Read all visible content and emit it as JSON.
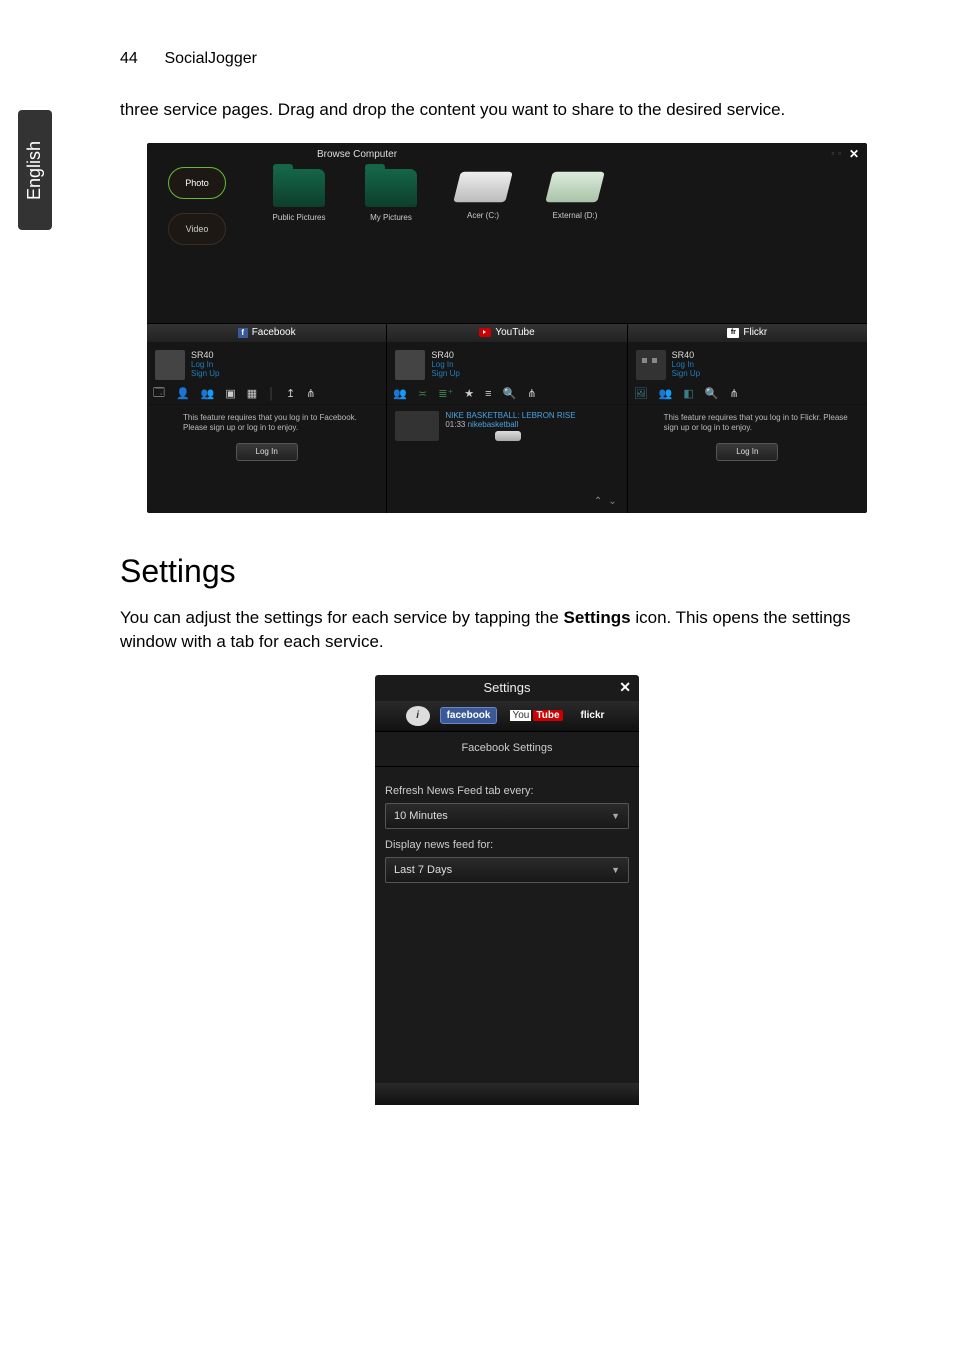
{
  "page": {
    "number": "44",
    "section": "SocialJogger",
    "language_tab": "English"
  },
  "text": {
    "intro_continued": "three service pages. Drag and drop the content you want to share to the desired service.",
    "settings_heading": "Settings",
    "settings_body_pre": "You can adjust the settings for each service by tapping the ",
    "settings_body_bold": "Settings",
    "settings_body_post": " icon. This opens the settings window with a tab for each service."
  },
  "shot1": {
    "browse_label": "Browse Computer",
    "left_tabs": {
      "photo": "Photo",
      "video": "Video"
    },
    "drives": {
      "public_pictures": "Public Pictures",
      "my_pictures": "My Pictures",
      "acer_c": "Acer (C:)",
      "external_d": "External (D:)"
    },
    "panels": {
      "facebook": "Facebook",
      "youtube": "YouTube",
      "flickr": "Flickr"
    },
    "user": {
      "name": "SR40",
      "login": "Log In",
      "signup": "Sign Up"
    },
    "facebook_notice": "This feature requires that you log in to Facebook. Please sign up or log in to enjoy.",
    "flickr_notice": "This feature requires that you log in to Flickr. Please sign up or log in to enjoy.",
    "login_button": "Log In",
    "youtube_video": {
      "title": "NIKE BASKETBALL: LEBRON RISE",
      "duration": "01:33",
      "channel": "nikebasketball"
    }
  },
  "shot2": {
    "title": "Settings",
    "tabs": {
      "facebook": "facebook",
      "youtube_you": "You",
      "youtube_tube": "Tube",
      "flickr": "flickr"
    },
    "subheading": "Facebook Settings",
    "refresh_label": "Refresh News Feed tab every:",
    "refresh_value": "10 Minutes",
    "display_label": "Display news feed for:",
    "display_value": "Last 7 Days"
  }
}
